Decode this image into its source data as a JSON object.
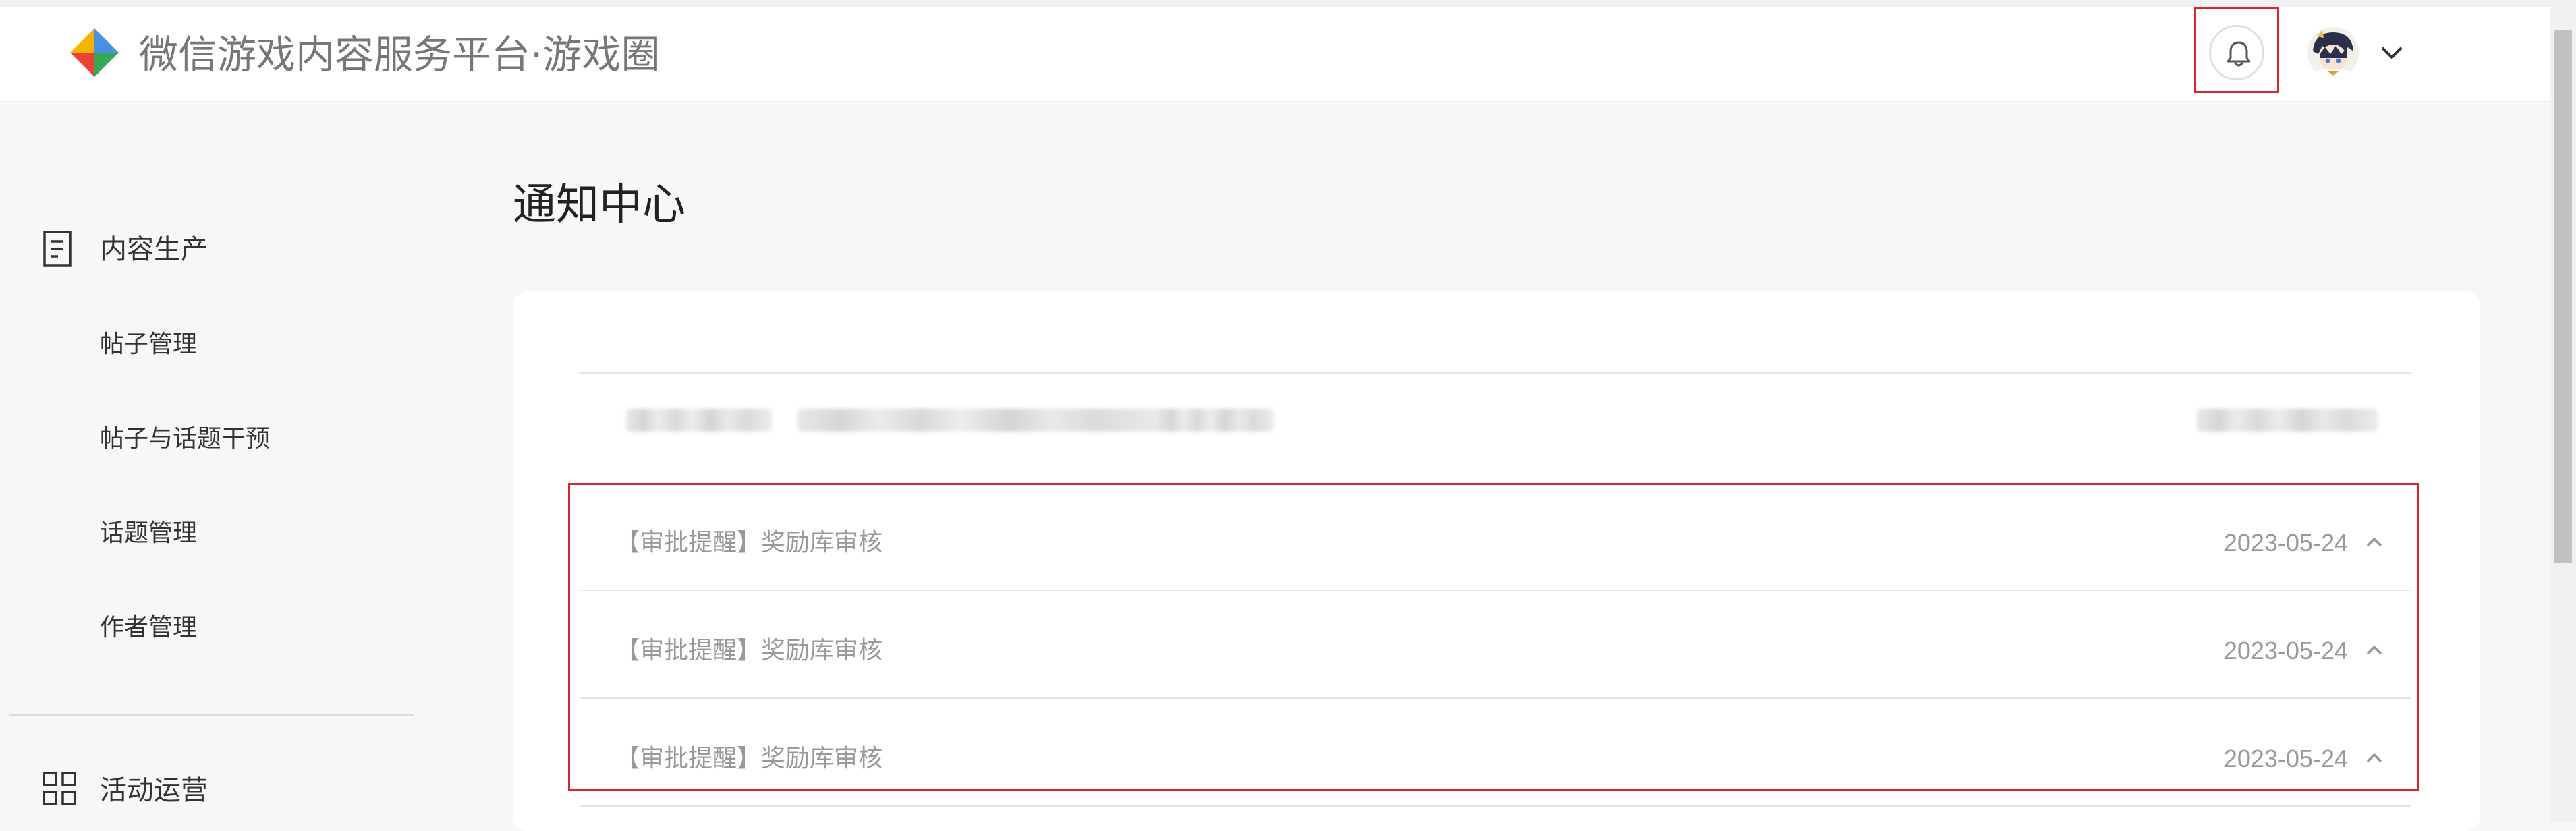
{
  "header": {
    "app_title": "微信游戏内容服务平台·游戏圈",
    "logo_icon": "colorful-diamond-logo-icon",
    "bell_icon": "bell-icon",
    "dropdown_icon": "chevron-down-icon",
    "highlight_color": "#d9252b"
  },
  "sidebar": {
    "groups": [
      {
        "label": "内容生产",
        "icon": "document-icon",
        "items": [
          "帖子管理",
          "帖子与话题干预",
          "话题管理",
          "作者管理"
        ]
      },
      {
        "label": "活动运营",
        "icon": "grid-icon",
        "items": []
      }
    ]
  },
  "main": {
    "page_title": "通知中心",
    "notifications": [
      {
        "title": "【审批提醒】奖励库审核",
        "date": "2023-05-24"
      },
      {
        "title": "【审批提醒】奖励库审核",
        "date": "2023-05-24"
      },
      {
        "title": "【审批提醒】奖励库审核",
        "date": "2023-05-24"
      }
    ]
  }
}
